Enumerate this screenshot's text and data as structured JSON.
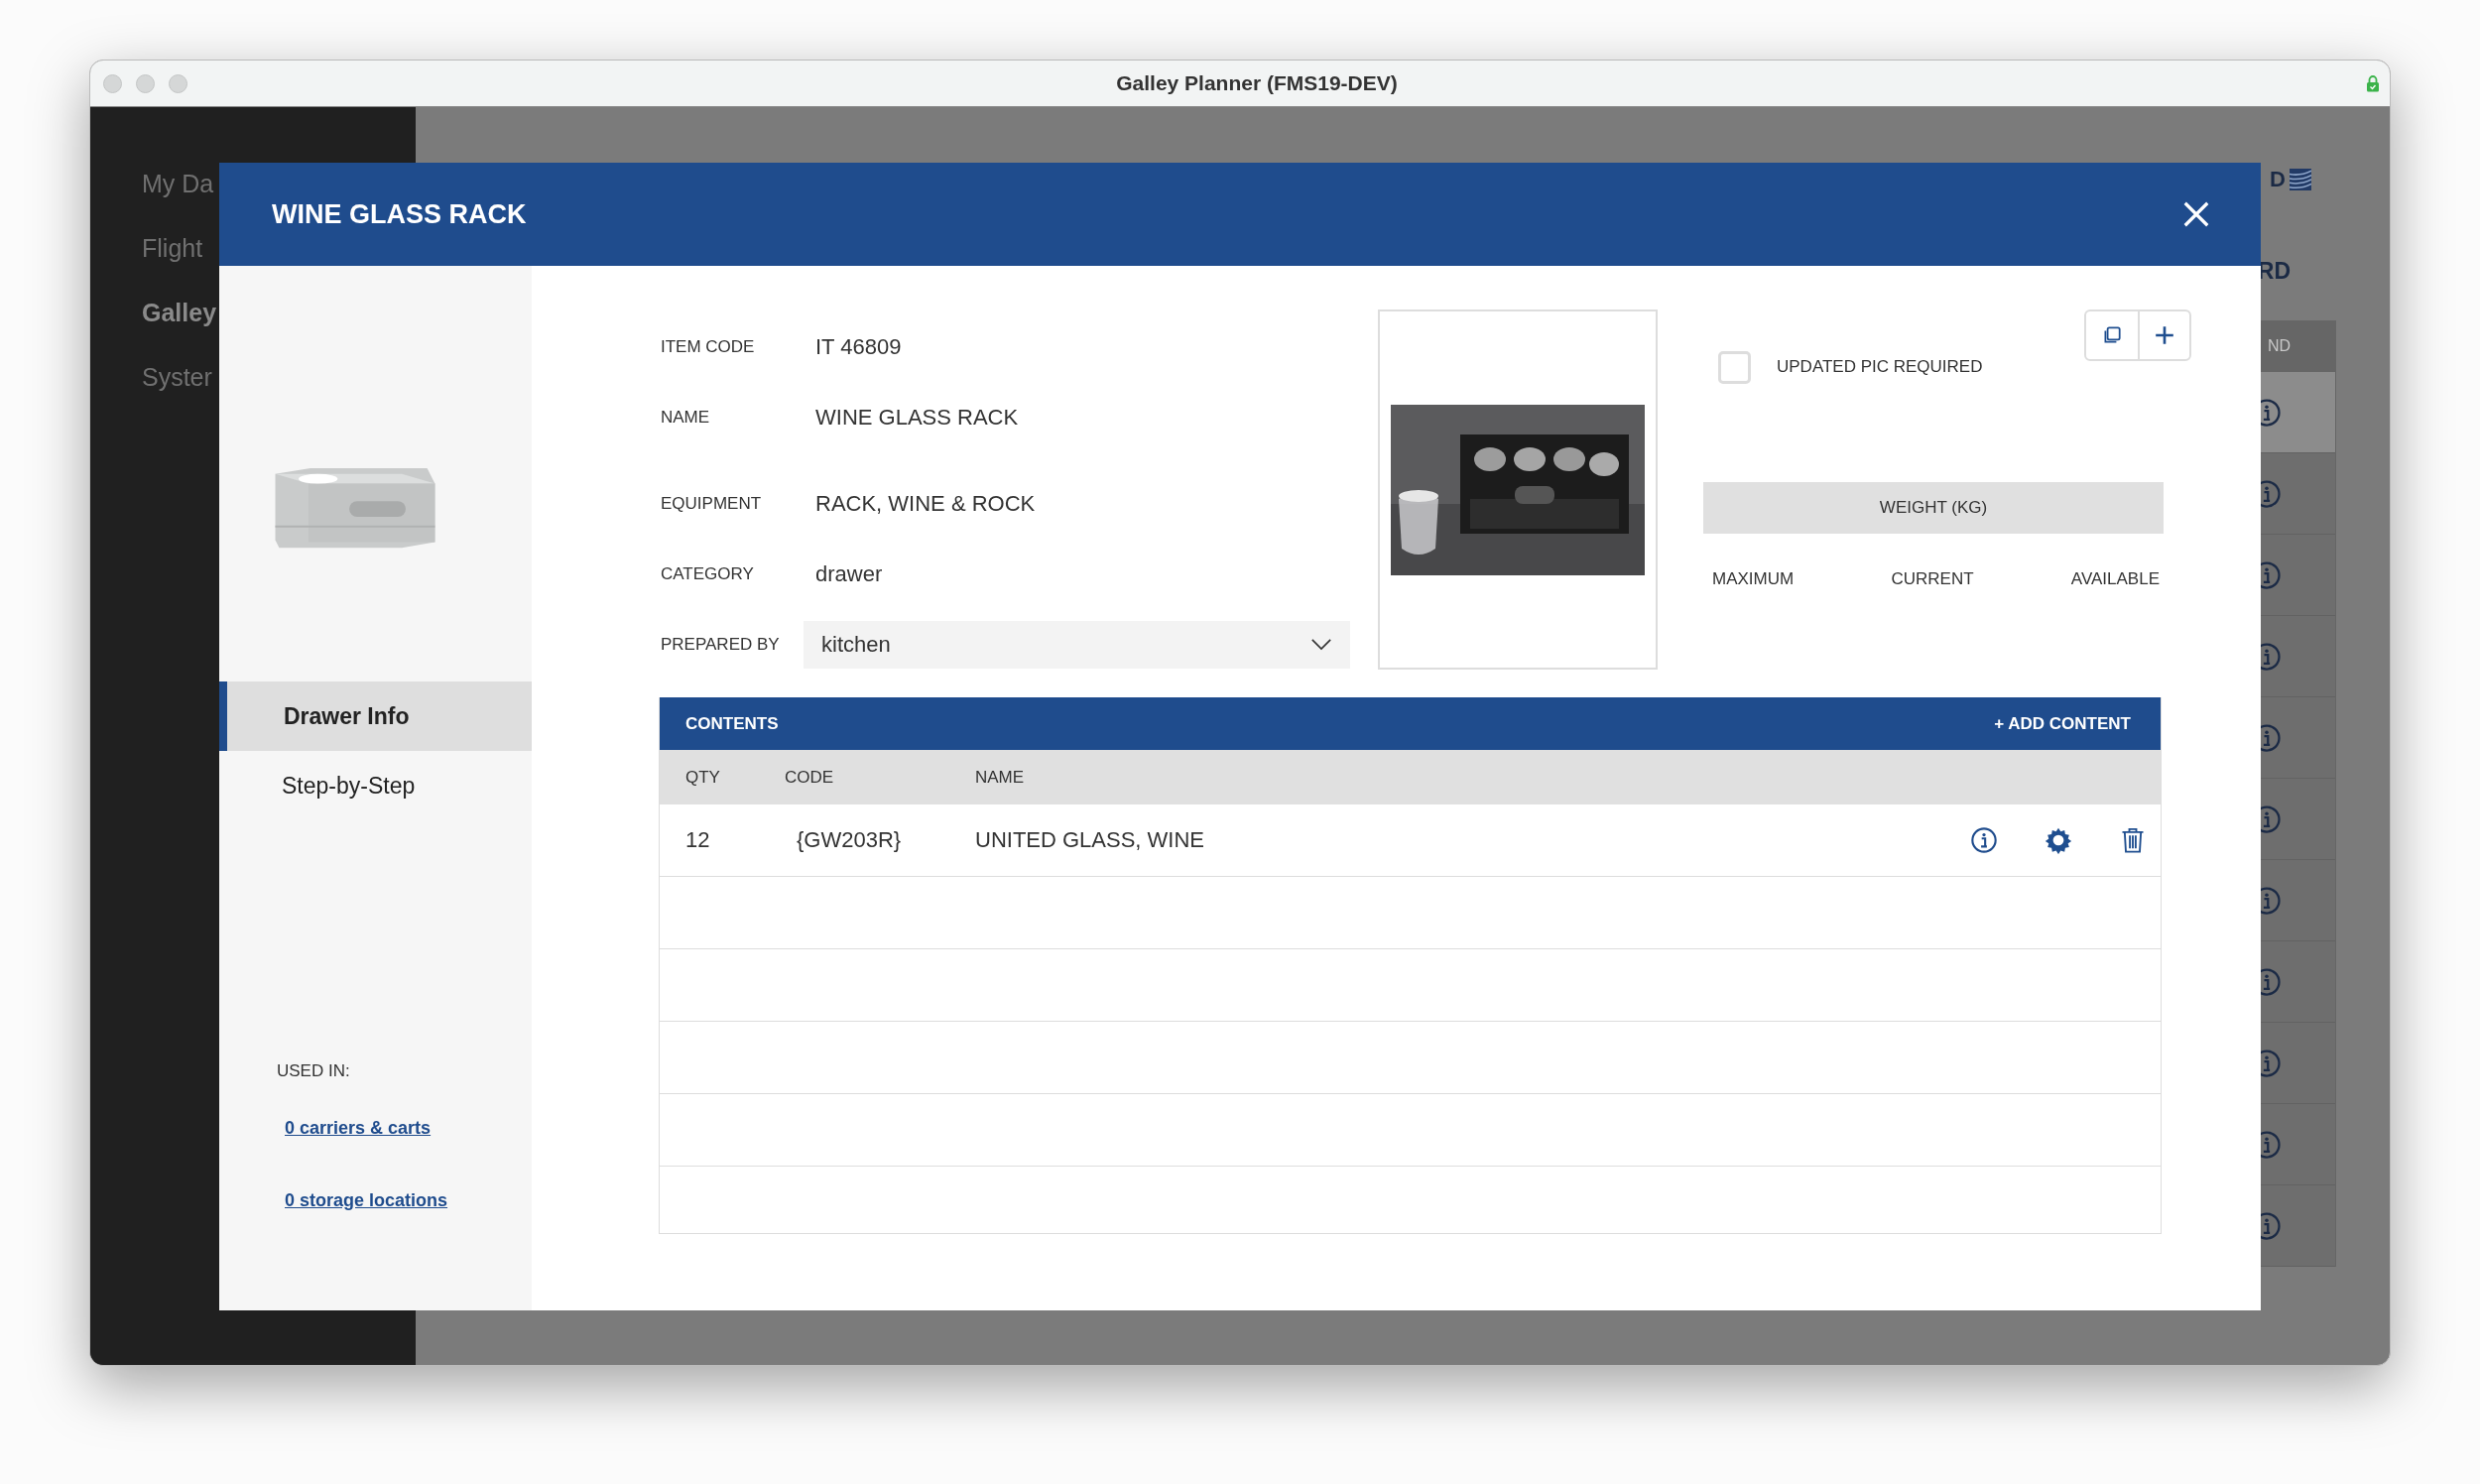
{
  "window": {
    "title": "Galley Planner (FMS19-DEV)"
  },
  "background": {
    "sidebar_items": [
      {
        "label": "My Da",
        "selected": false
      },
      {
        "label": "Flight",
        "selected": false
      },
      {
        "label": "Galley",
        "selected": true
      },
      {
        "label": "Syster",
        "selected": false
      }
    ],
    "logo_text": "D",
    "heading": "RD",
    "table": {
      "column_header": "ND",
      "rows": [
        {
          "selected": true
        },
        {
          "selected": false
        },
        {
          "selected": false
        },
        {
          "selected": false
        },
        {
          "selected": false
        },
        {
          "selected": false
        },
        {
          "selected": false
        },
        {
          "selected": false
        },
        {
          "selected": false
        },
        {
          "selected": false
        },
        {
          "selected": false
        }
      ]
    }
  },
  "modal": {
    "title": "WINE GLASS RACK",
    "nav": [
      {
        "label": "Drawer Info",
        "selected": true
      },
      {
        "label": "Step-by-Step",
        "selected": false
      }
    ],
    "used_in": {
      "label": "USED IN:",
      "links": [
        "0 carriers & carts",
        "0 storage locations"
      ]
    },
    "fields": [
      {
        "label": "ITEM CODE",
        "value": "IT 46809",
        "kind": "text"
      },
      {
        "label": "NAME",
        "value": "WINE GLASS RACK",
        "kind": "text"
      },
      {
        "label": "EQUIPMENT",
        "value": "RACK, WINE & ROCK",
        "kind": "text"
      },
      {
        "label": "CATEGORY",
        "value": "drawer",
        "kind": "text"
      },
      {
        "label": "PREPARED BY",
        "value": "kitchen",
        "kind": "dropdown"
      }
    ],
    "checkbox": {
      "label": "UPDATED PIC REQUIRED",
      "checked": false
    },
    "weight": {
      "title": "WEIGHT (KG)",
      "columns": [
        "MAXIMUM",
        "CURRENT",
        "AVAILABLE"
      ]
    },
    "contents": {
      "title": "CONTENTS",
      "add_label": "+ ADD CONTENT",
      "columns": [
        "QTY",
        "CODE",
        "NAME"
      ],
      "rows": [
        {
          "qty": "12",
          "code": "{GW203R}",
          "name": "UNITED GLASS, WINE"
        }
      ]
    }
  }
}
